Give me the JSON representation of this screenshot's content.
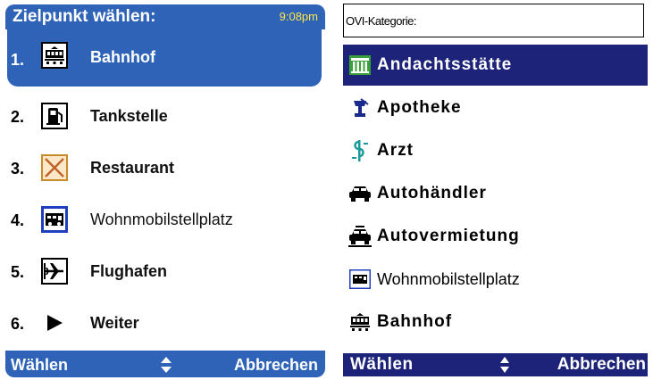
{
  "left_screen": {
    "title": "Zielpunkt wählen:",
    "time": "9:08pm",
    "items": [
      {
        "number": "1.",
        "label": "Bahnhof",
        "icon": "train-icon",
        "selected": true
      },
      {
        "number": "2.",
        "label": "Tankstelle",
        "icon": "fuel-station-icon"
      },
      {
        "number": "3.",
        "label": "Restaurant",
        "icon": "restaurant-icon"
      },
      {
        "number": "4.",
        "label": "Wohnmobilstellplatz",
        "icon": "camper-icon"
      },
      {
        "number": "5.",
        "label": "Flughafen",
        "icon": "airplane-icon"
      },
      {
        "number": "6.",
        "label": "Weiter",
        "icon": "play-arrow-icon"
      }
    ],
    "softkeys": {
      "left": "Wählen",
      "right": "Abbrechen"
    }
  },
  "right_screen": {
    "title": "OVI-Kategorie:",
    "items": [
      {
        "label": "Andachtsstätte",
        "icon": "temple-icon",
        "selected": true
      },
      {
        "label": "Apotheke",
        "icon": "pharmacy-icon"
      },
      {
        "label": "Arzt",
        "icon": "doctor-icon"
      },
      {
        "label": "Autohändler",
        "icon": "car-dealer-icon"
      },
      {
        "label": "Autovermietung",
        "icon": "car-rental-icon"
      },
      {
        "label": "Wohnmobilstellplatz",
        "icon": "camper-icon"
      },
      {
        "label": "Bahnhof",
        "icon": "train-icon"
      }
    ],
    "softkeys": {
      "left": "Wählen",
      "right": "Abbrechen"
    }
  },
  "colors": {
    "left_accent": "#2e63b8",
    "right_accent": "#1c2378",
    "time_color": "#ffe54a"
  }
}
